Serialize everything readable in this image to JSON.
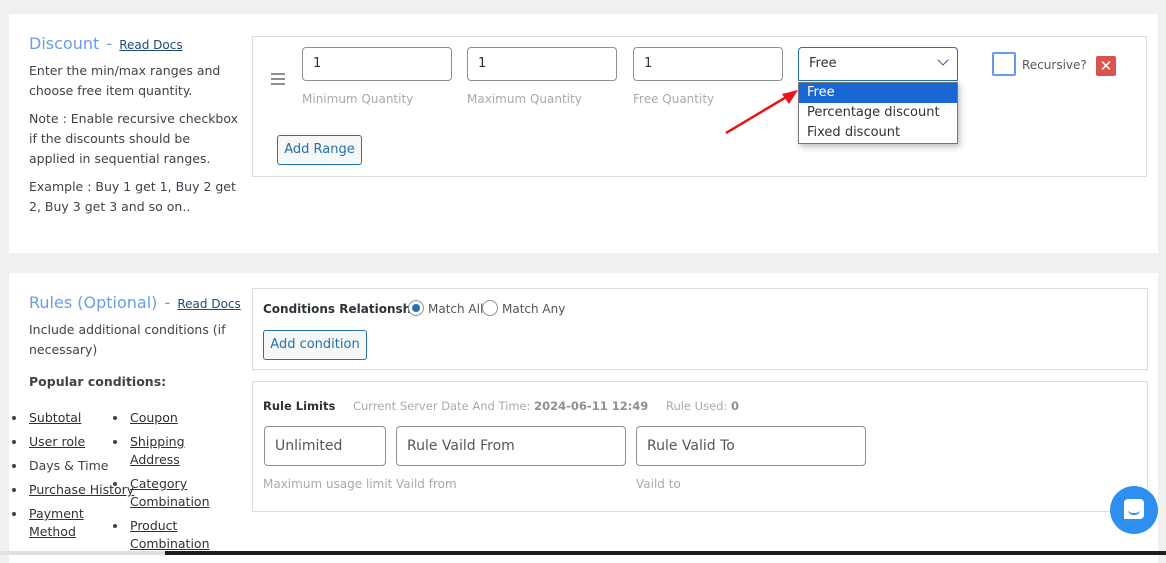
{
  "discount": {
    "title": "Discount",
    "dash": "-",
    "read_docs": "Read Docs",
    "desc1": "Enter the min/max ranges and choose free item quantity.",
    "desc2": "Note : Enable recursive checkbox if the discounts should be applied in sequential ranges.",
    "desc3": "Example : Buy 1 get 1, Buy 2 get 2, Buy 3 get 3 and so on..",
    "range": {
      "min_qty_value": "1",
      "max_qty_value": "1",
      "free_qty_value": "1",
      "min_qty_label": "Minimum Quantity",
      "max_qty_label": "Maximum Quantity",
      "free_qty_label": "Free Quantity",
      "type_selected": "Free",
      "type_options": [
        "Free",
        "Percentage discount",
        "Fixed discount"
      ],
      "recursive_label": "Recursive?",
      "recursive_checked": false,
      "remove_icon": "close-icon"
    },
    "add_range_label": "Add Range"
  },
  "rules": {
    "title": "Rules (Optional)",
    "dash": "-",
    "read_docs": "Read Docs",
    "desc": "Include additional conditions (if necessary)",
    "popular_label": "Popular conditions:",
    "popular_col1": [
      {
        "label": "Subtotal",
        "link": true
      },
      {
        "label": "User role",
        "link": true
      },
      {
        "label": "Days & Time",
        "link": false
      },
      {
        "label": "Purchase History",
        "link": true
      },
      {
        "label": "Payment Method",
        "link": true
      }
    ],
    "popular_col2": [
      {
        "label": "Coupon",
        "link": true
      },
      {
        "label": "Shipping Address",
        "link": true
      },
      {
        "label": "Category Combination",
        "link": true
      },
      {
        "label": "Product Combination",
        "link": true
      }
    ],
    "conditions_relationship_label": "Conditions Relationship",
    "match_all_label": "Match All",
    "match_any_label": "Match Any",
    "match_selected": "Match All",
    "add_condition_label": "Add condition",
    "limits": {
      "title": "Rule Limits",
      "server_time_label": "Current Server Date And Time:",
      "server_time_value": "2024-06-11 12:49",
      "rule_used_label": "Rule Used:",
      "rule_used_value": "0",
      "max_usage_placeholder": "Unlimited",
      "valid_from_placeholder": "Rule Vaild From",
      "valid_to_placeholder": "Rule Valid To",
      "max_usage_label": "Maximum usage limit",
      "valid_from_label": "Vaild from",
      "valid_to_label": "Vaild to"
    }
  },
  "chat": {
    "icon": "chat-bubble-icon"
  },
  "colors": {
    "accent": "#2271b1",
    "title": "#6a9be8",
    "danger": "#d9534f",
    "chat": "#2f8ff0",
    "selected_option": "#1a66d2"
  }
}
